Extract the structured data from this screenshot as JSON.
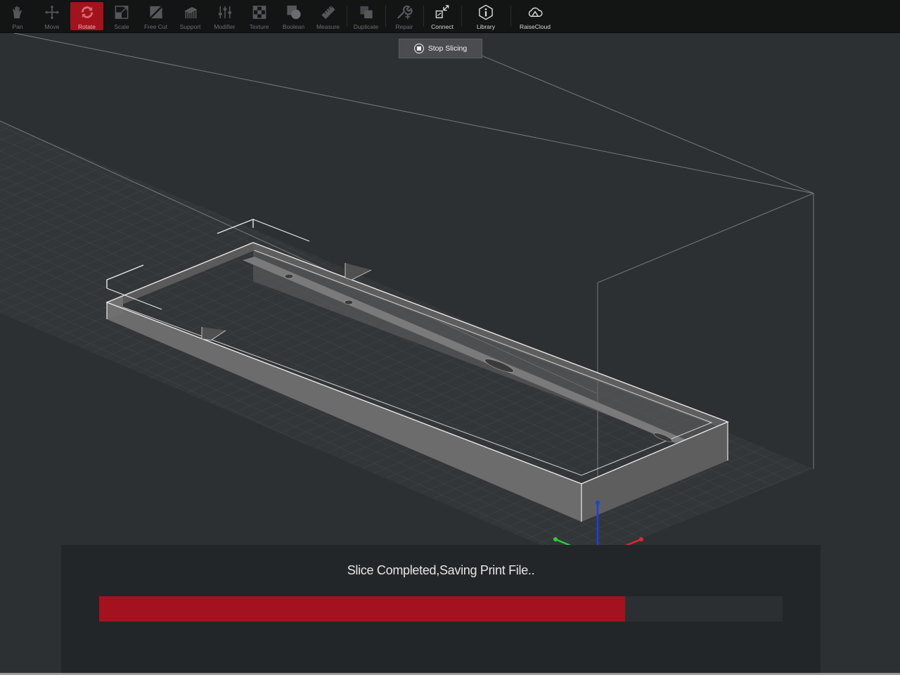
{
  "toolbar": {
    "tools": [
      {
        "id": "pan",
        "label": "Pan",
        "icon": "hand-icon"
      },
      {
        "id": "move",
        "label": "Move",
        "icon": "move-arrows-icon"
      },
      {
        "id": "rotate",
        "label": "Rotate",
        "icon": "rotate-icon",
        "active": true
      },
      {
        "id": "scale",
        "label": "Scale",
        "icon": "scale-icon"
      },
      {
        "id": "freecut",
        "label": "Free Cut",
        "icon": "free-cut-icon"
      },
      {
        "id": "support",
        "label": "Support",
        "icon": "support-icon"
      },
      {
        "id": "modifier",
        "label": "Modifier",
        "icon": "modifier-sliders-icon"
      },
      {
        "id": "texture",
        "label": "Texture",
        "icon": "texture-checker-icon"
      },
      {
        "id": "boolean",
        "label": "Boolean",
        "icon": "boolean-icon"
      },
      {
        "id": "measure",
        "label": "Measure",
        "icon": "ruler-icon"
      },
      {
        "id": "duplicate",
        "label": "Duplicate",
        "icon": "duplicate-icon"
      },
      {
        "id": "repair",
        "label": "Repair",
        "icon": "wrench-icon"
      },
      {
        "id": "connect",
        "label": "Connect",
        "icon": "connect-icon"
      },
      {
        "id": "library",
        "label": "Library",
        "icon": "info-hexagon-icon"
      },
      {
        "id": "raisecloud",
        "label": "RaiseCloud",
        "icon": "cloud-icon"
      }
    ]
  },
  "stop_button": {
    "label": "Stop Slicing",
    "icon": "stop-circle-icon"
  },
  "progress": {
    "status_text": "Slice Completed,Saving Print File..",
    "fraction": 0.77
  },
  "colors": {
    "accent": "#a5121f",
    "toolbar_bg": "#131414",
    "viewport_bg": "#2d3033",
    "panel_bg": "#232628",
    "model_gray": "#6e6e6e",
    "axis_x": "#e0282e",
    "axis_y": "#2ccf3a",
    "axis_z": "#1f3fe0"
  }
}
